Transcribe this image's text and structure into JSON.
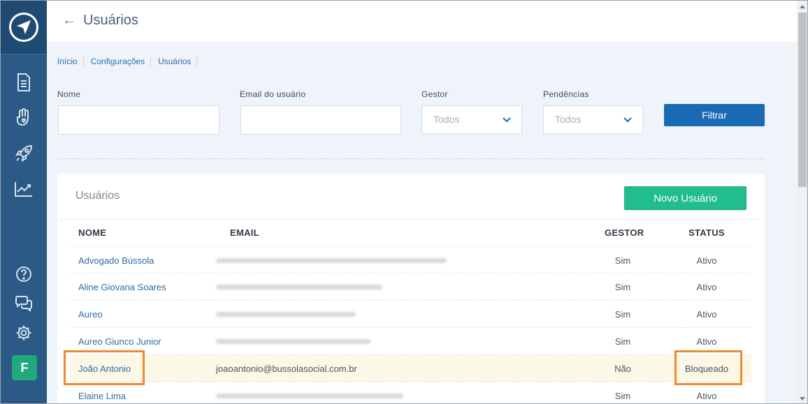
{
  "header": {
    "title": "Usuários",
    "back_icon": "arrow-left-icon"
  },
  "breadcrumb": [
    "Início",
    "Configurações",
    "Usuários"
  ],
  "filters": {
    "nome_label": "Nome",
    "email_label": "Email do usuário",
    "gestor_label": "Gestor",
    "gestor_value": "Todos",
    "pendencias_label": "Pendências",
    "pendencias_value": "Todos",
    "filter_button": "Filtrar"
  },
  "users_card": {
    "title": "Usuários",
    "new_button": "Novo Usuário",
    "columns": {
      "name": "NOME",
      "email": "EMAIL",
      "gestor": "GESTOR",
      "status": "STATUS"
    },
    "rows": [
      {
        "name": "Advogado Bússola",
        "email": "",
        "gestor": "Sim",
        "status": "Ativo"
      },
      {
        "name": "Aline Giovana Soares",
        "email": "",
        "gestor": "Sim",
        "status": "Ativo"
      },
      {
        "name": "Aureo",
        "email": "",
        "gestor": "Sim",
        "status": "Ativo"
      },
      {
        "name": "Aureo Giunco Junior",
        "email": "",
        "gestor": "Sim",
        "status": "Ativo"
      },
      {
        "name": "João Antonio",
        "email": "joaoantonio@bussolasocial.com.br",
        "gestor": "Não",
        "status": "Bloqueado"
      },
      {
        "name": "Elaine Lima",
        "email": "",
        "gestor": "Sim",
        "status": "Ativo"
      }
    ]
  },
  "sidebar": {
    "icons": [
      "document-icon",
      "hand-heart-icon",
      "rocket-icon",
      "chart-icon",
      "help-icon",
      "chat-icon",
      "gear-icon"
    ],
    "avatar_letter": "F"
  },
  "colors": {
    "sidebar": "#2b5a86",
    "primary_button": "#1b6ab5",
    "new_button": "#21bd8c",
    "highlight": "#f08a2e"
  }
}
